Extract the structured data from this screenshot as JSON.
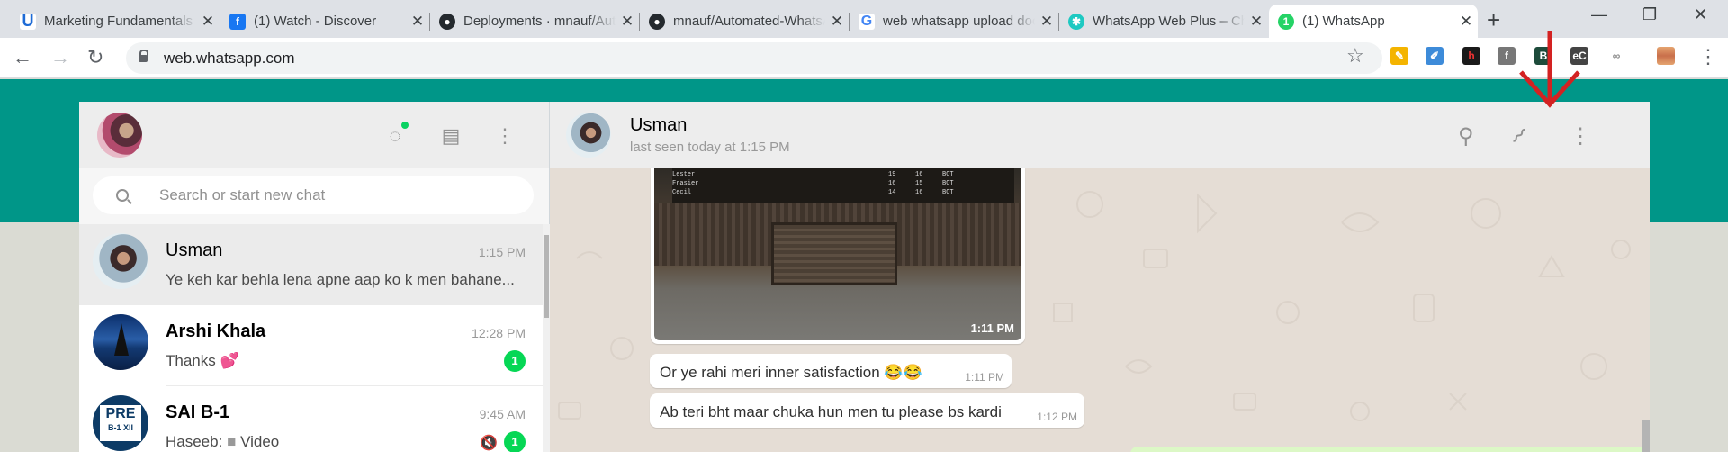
{
  "browser": {
    "tabs": [
      {
        "title": "Marketing Fundamentals",
        "favicon": "U",
        "color": "#1e6bd6"
      },
      {
        "title": "(1) Watch - Discover",
        "favicon": "f",
        "color": "#1877f2"
      },
      {
        "title": "Deployments · mnauf/Automated-WhatsApp",
        "favicon": "gh",
        "color": "#24292e"
      },
      {
        "title": "mnauf/Automated-WhatsApp",
        "favicon": "gh",
        "color": "#24292e"
      },
      {
        "title": "web whatsapp upload document",
        "favicon": "G",
        "color": "#4285f4"
      },
      {
        "title": "WhatsApp Web Plus – Chrome",
        "favicon": "puzzle",
        "color": "#1ec9c2"
      },
      {
        "title": "(1) WhatsApp",
        "favicon": "1",
        "color": "#25d366"
      }
    ],
    "url": "web.whatsapp.com"
  },
  "sidebar": {
    "search_placeholder": "Search or start new chat",
    "chats": [
      {
        "name": "Usman",
        "time": "1:15 PM",
        "preview": "Ye keh kar behla lena apne aap ko k men bahane...",
        "unread": "",
        "selected": true
      },
      {
        "name": "Arshi Khala",
        "time": "12:28 PM",
        "preview": "Thanks 💕",
        "unread": "1",
        "selected": false
      },
      {
        "name": "SAI B-1",
        "time": "9:45 AM",
        "preview_sender": "Haseeb:",
        "preview": "Video",
        "unread": "1",
        "muted": true,
        "selected": false
      }
    ]
  },
  "conversation": {
    "contact_name": "Usman",
    "last_seen": "last seen today at 1:15 PM",
    "messages": [
      {
        "type": "image",
        "time": "1:11 PM",
        "caption": ""
      },
      {
        "type": "text",
        "text": "Or ye rahi meri inner satisfaction 😂😂",
        "time": "1:11 PM"
      },
      {
        "type": "text",
        "text": "Ab teri bht maar chuka hun men tu please bs kardi",
        "time": "1:12 PM"
      }
    ],
    "image_table": [
      {
        "name": "Lester",
        "a": "19",
        "b": "16",
        "c": "BOT"
      },
      {
        "name": "Frasier",
        "a": "16",
        "b": "15",
        "c": "BOT"
      },
      {
        "name": "Cecil",
        "a": "14",
        "b": "16",
        "c": "BOT"
      }
    ]
  },
  "colors": {
    "teal": "#009688",
    "arrow": "#d32222",
    "badge": "#06d755"
  }
}
